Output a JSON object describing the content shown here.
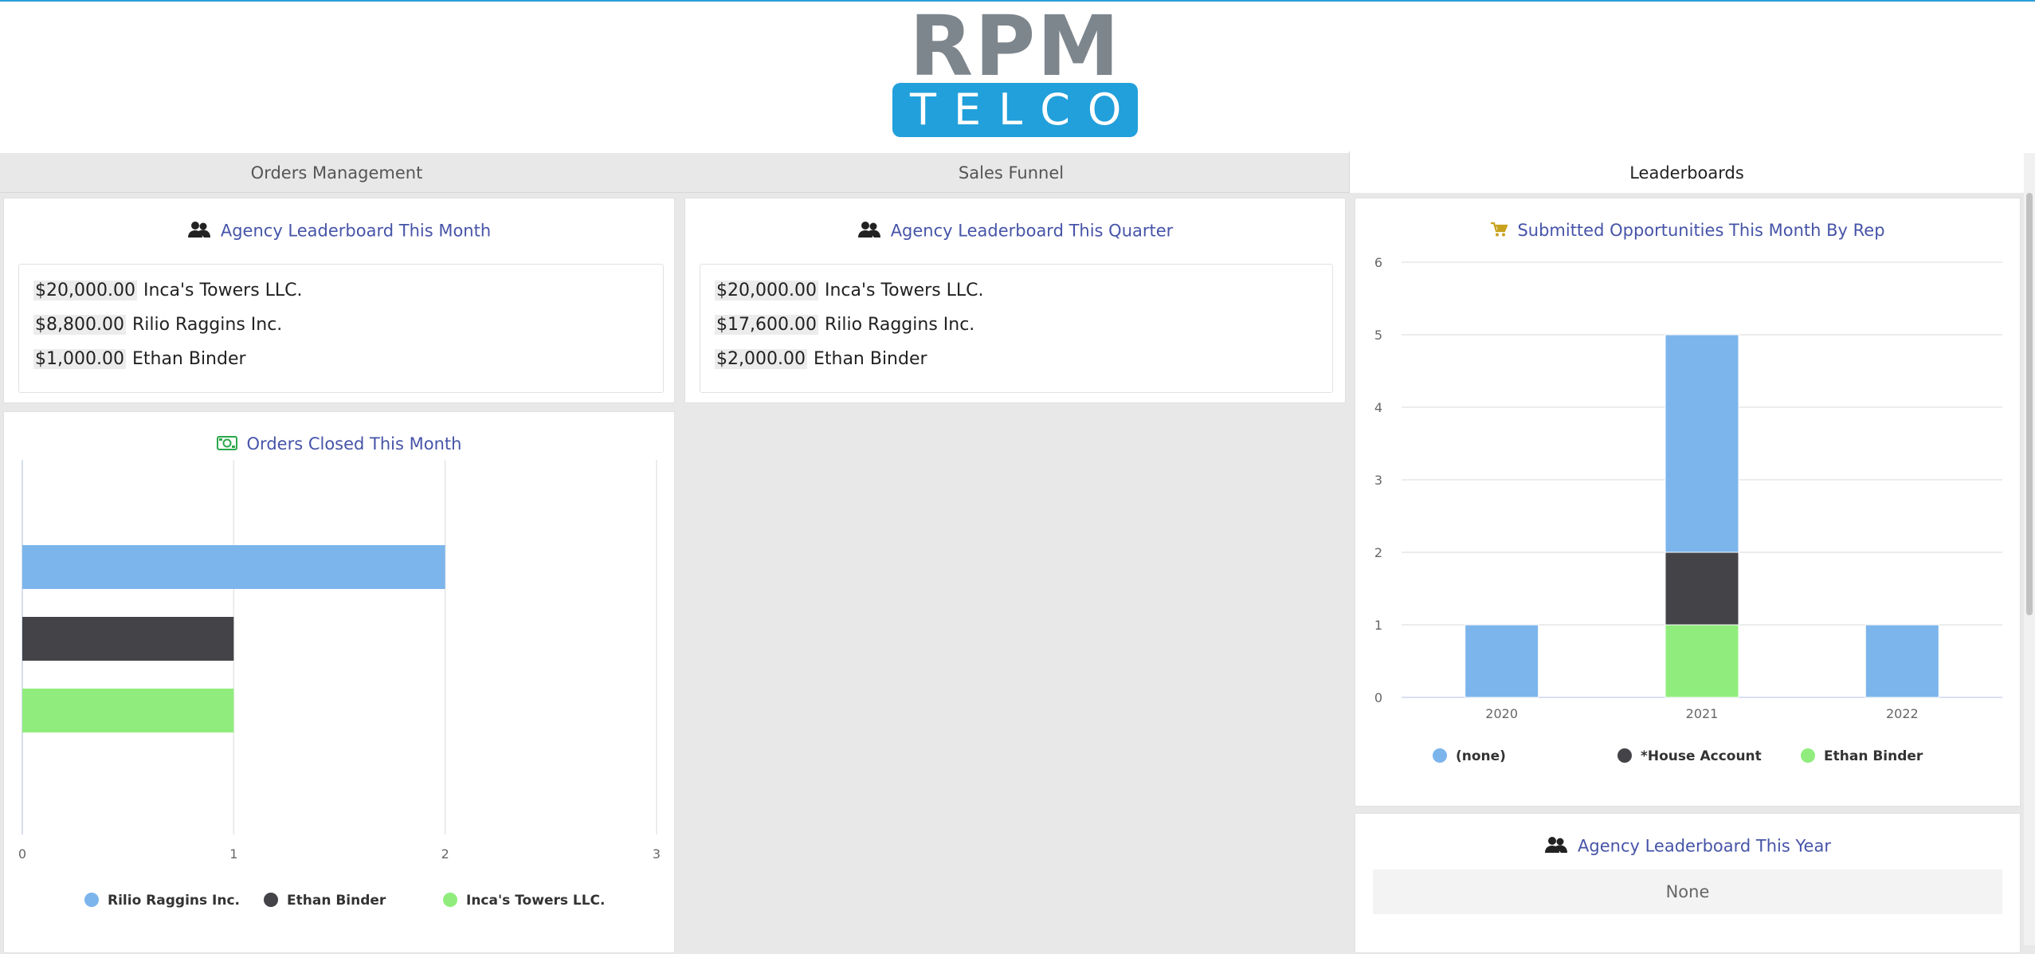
{
  "logo": {
    "top": "RPM",
    "bottom": "TELCO"
  },
  "tabs": [
    {
      "label": "Orders Management"
    },
    {
      "label": "Sales Funnel"
    },
    {
      "label": "Leaderboards"
    }
  ],
  "month_board": {
    "title": "Agency Leaderboard This Month",
    "icon": "users-icon",
    "rows": [
      {
        "amount": "$20,000.00",
        "name": "Inca's Towers LLC."
      },
      {
        "amount": "$8,800.00",
        "name": "Rilio Raggins Inc."
      },
      {
        "amount": "$1,000.00",
        "name": "Ethan Binder"
      }
    ]
  },
  "quarter_board": {
    "title": "Agency Leaderboard This Quarter",
    "icon": "users-icon",
    "rows": [
      {
        "amount": "$20,000.00",
        "name": "Inca's Towers LLC."
      },
      {
        "amount": "$17,600.00",
        "name": "Rilio Raggins Inc."
      },
      {
        "amount": "$2,000.00",
        "name": "Ethan Binder"
      }
    ]
  },
  "year_board": {
    "title": "Agency Leaderboard This Year",
    "icon": "users-icon",
    "value": "None"
  },
  "colors": {
    "blue": "#7cb5ec",
    "dark": "#434348",
    "green": "#90ed7d",
    "title": "#4654a8"
  },
  "chart_data": [
    {
      "type": "bar",
      "orientation": "horizontal",
      "title": "Orders Closed This Month",
      "icon": "money-icon",
      "categories": [
        "Rilio Raggins Inc.",
        "Ethan Binder",
        "Inca's Towers LLC."
      ],
      "series": [
        {
          "name": "Rilio Raggins Inc.",
          "values": [
            2
          ],
          "color": "#7cb5ec"
        },
        {
          "name": "Ethan Binder",
          "values": [
            1
          ],
          "color": "#434348"
        },
        {
          "name": "Inca's Towers LLC.",
          "values": [
            1
          ],
          "color": "#90ed7d"
        }
      ],
      "xlim": [
        0,
        3
      ],
      "ticks": [
        "0",
        "1",
        "2",
        "3"
      ],
      "legend": "bottom",
      "grid": true
    },
    {
      "type": "bar",
      "stacked": true,
      "title": "Submitted Opportunities This Month By Rep",
      "icon": "cart-icon",
      "categories": [
        "2020",
        "2021",
        "2022"
      ],
      "series": [
        {
          "name": "(none)",
          "values": [
            1,
            3,
            1
          ],
          "color": "#7cb5ec"
        },
        {
          "name": "*House Account",
          "values": [
            0,
            1,
            0
          ],
          "color": "#434348"
        },
        {
          "name": "Ethan Binder",
          "values": [
            0,
            1,
            0
          ],
          "color": "#90ed7d"
        }
      ],
      "ylim": [
        0,
        6
      ],
      "ticks": [
        "0",
        "1",
        "2",
        "3",
        "4",
        "5",
        "6"
      ],
      "legend": "bottom",
      "grid": true
    }
  ]
}
